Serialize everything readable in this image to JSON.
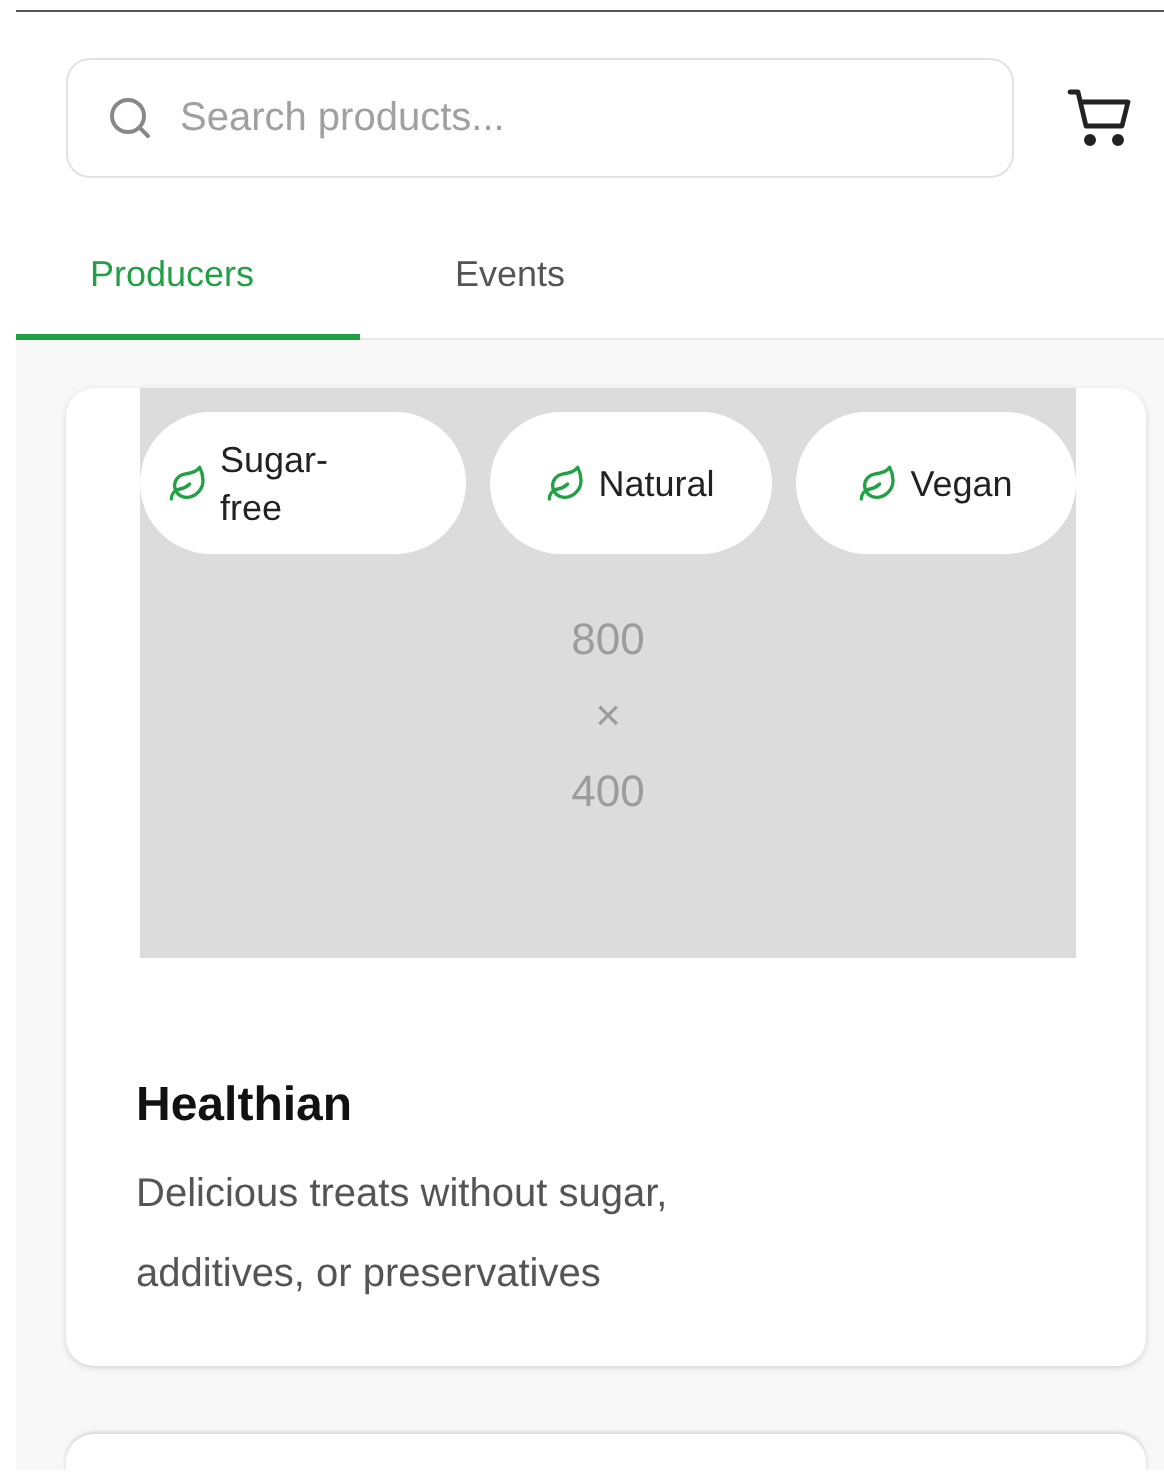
{
  "search": {
    "placeholder": "Search products..."
  },
  "tabs": [
    {
      "label": "Producers",
      "selected": true
    },
    {
      "label": "Events",
      "selected": false
    }
  ],
  "producers": [
    {
      "name": "Healthian",
      "description": "Delicious treats without sugar, additives, or preservatives",
      "image_placeholder": [
        "800",
        "×",
        "400"
      ],
      "tags": [
        {
          "label": "Sugar-free"
        },
        {
          "label": "Natural"
        },
        {
          "label": "Vegan"
        }
      ]
    }
  ]
}
